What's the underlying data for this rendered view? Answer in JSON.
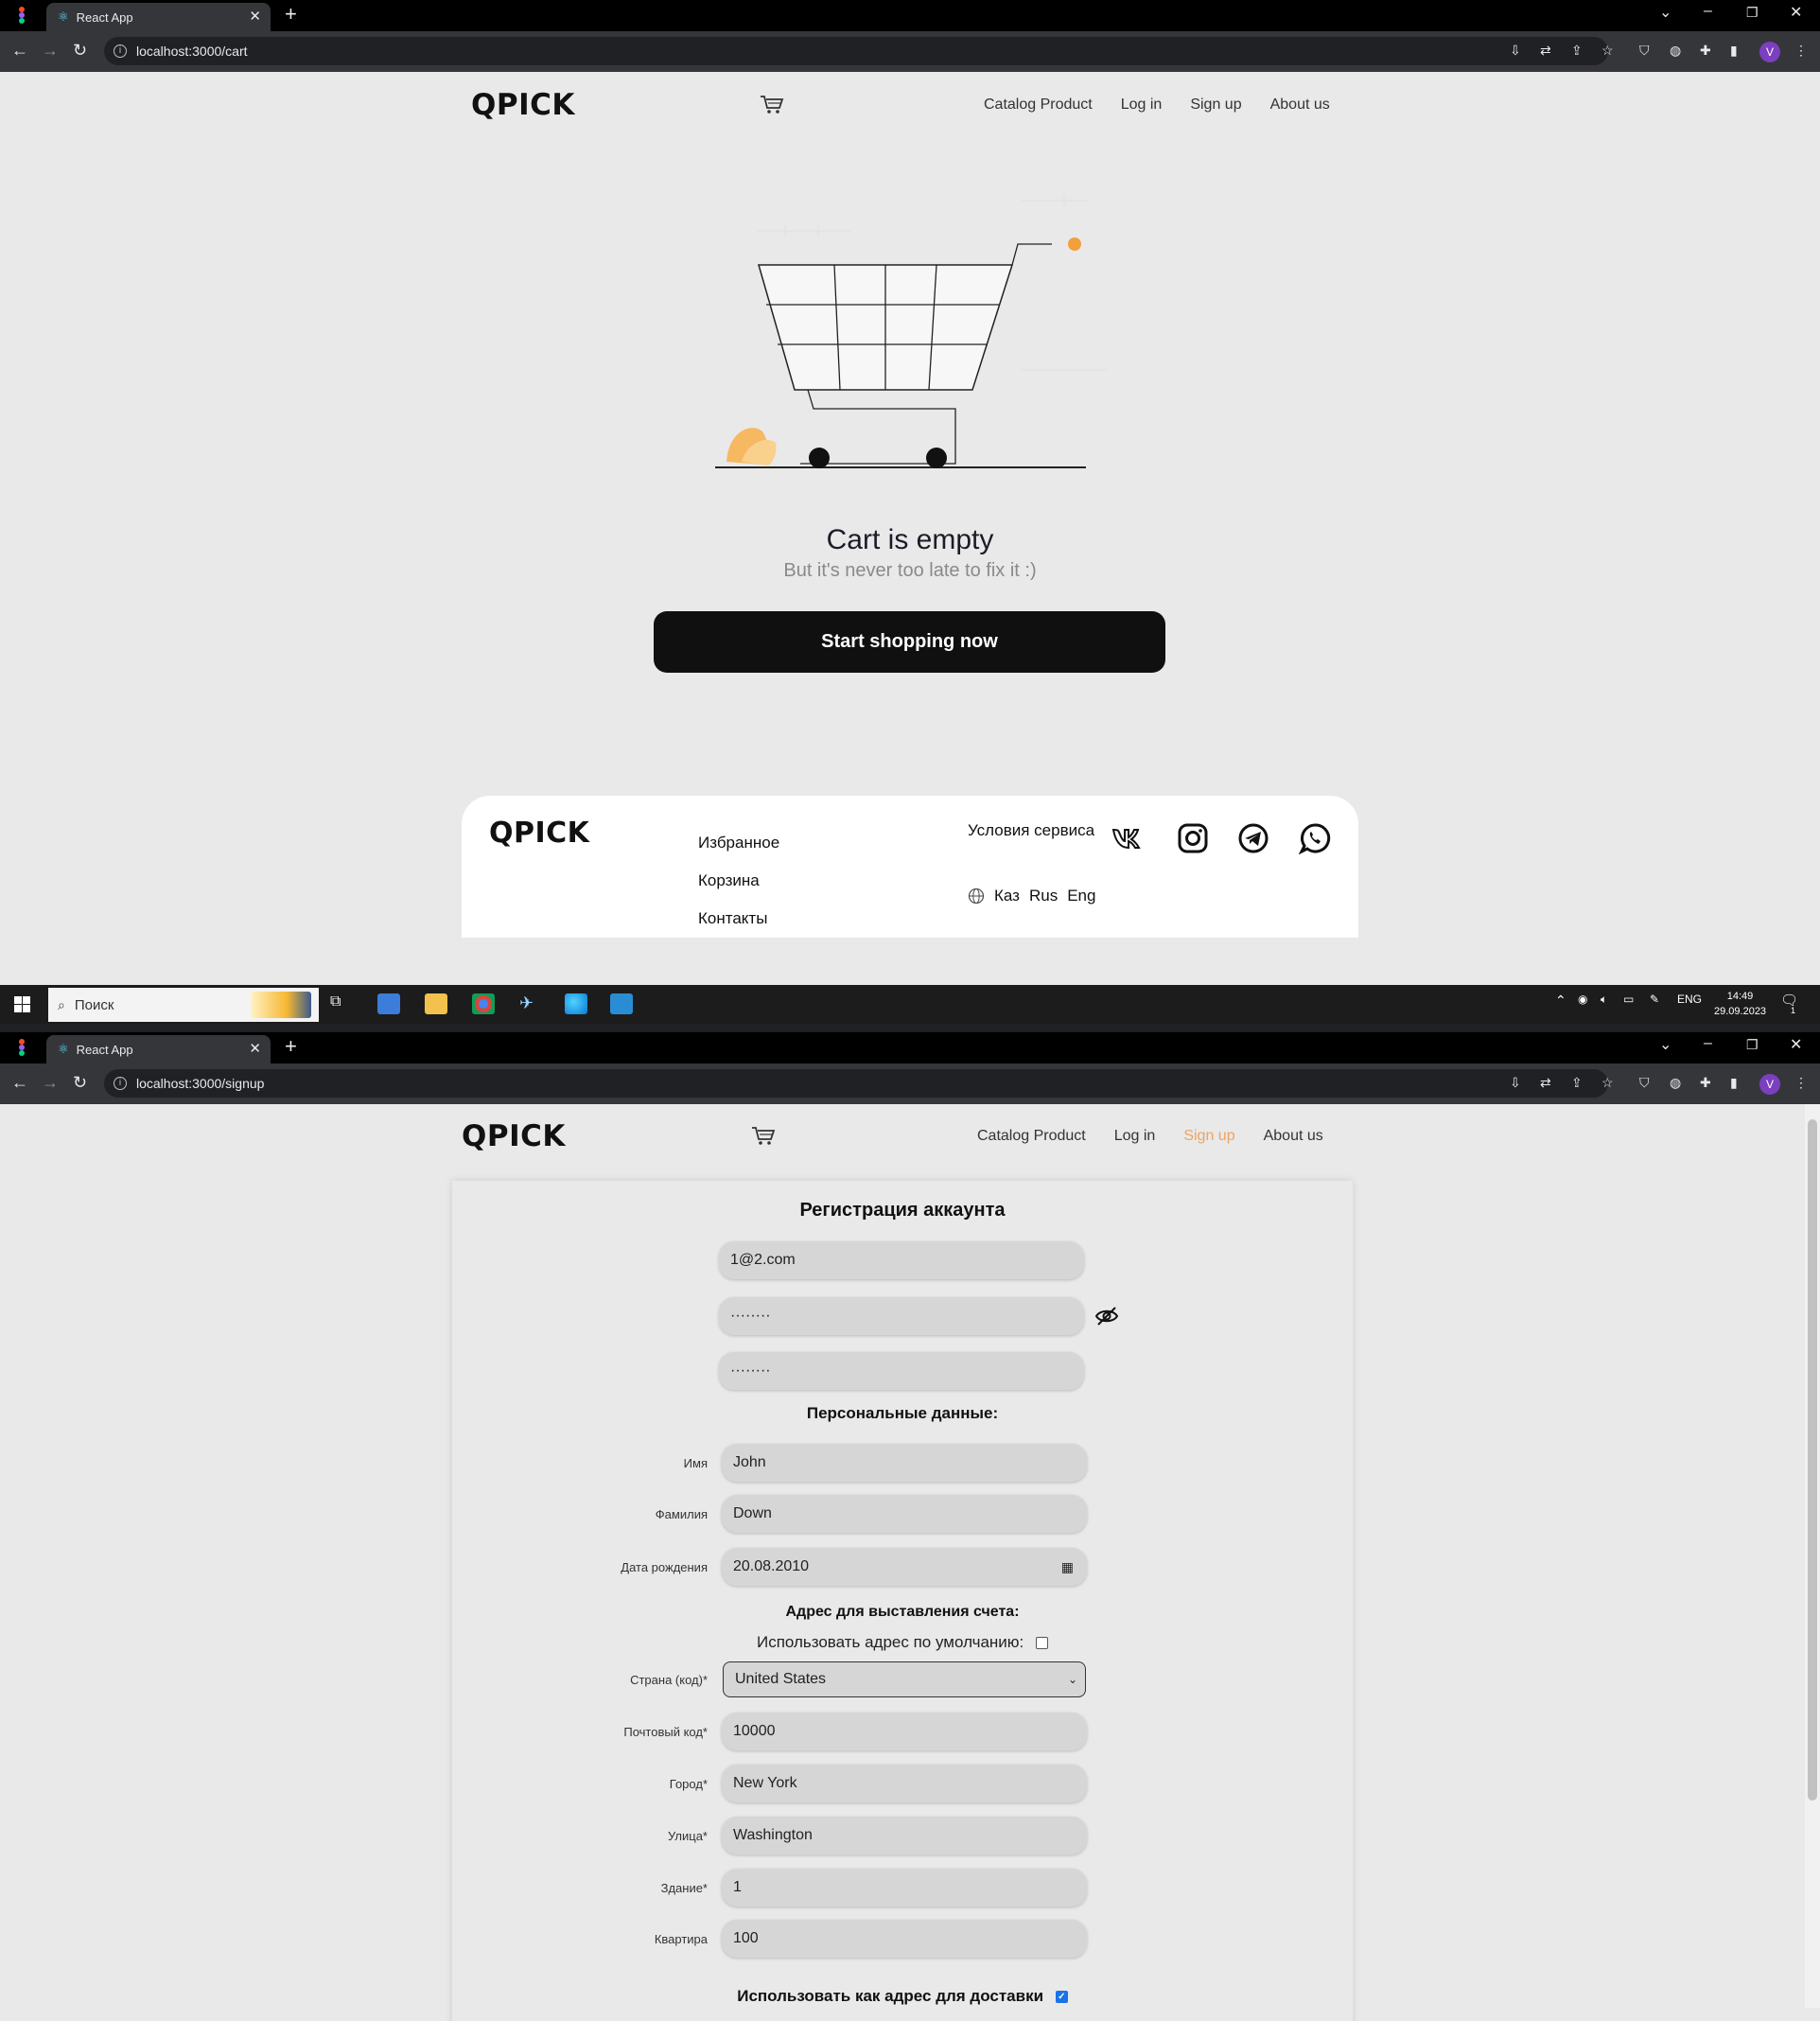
{
  "window1": {
    "tab_title": "React App",
    "url": "localhost:3000/cart",
    "header": {
      "logo": "QPICK",
      "nav": [
        "Catalog Product",
        "Log in",
        "Sign up",
        "About us"
      ]
    },
    "empty": {
      "title": "Cart is empty",
      "subtitle": "But it's never too late to fix it :)",
      "button": "Start shopping now"
    },
    "footer": {
      "logo": "QPICK",
      "links": [
        "Избранное",
        "Корзина",
        "Контакты"
      ],
      "terms": "Условия сервиса",
      "languages": [
        "Каз",
        "Rus",
        "Eng"
      ],
      "social_icons": [
        "vk-icon",
        "instagram-icon",
        "telegram-icon",
        "whatsapp-icon"
      ]
    }
  },
  "taskbar": {
    "search_placeholder": "Поиск",
    "lang": "ENG",
    "time": "14:49",
    "date": "29.09.2023",
    "notifications": "1"
  },
  "window2": {
    "tab_title": "React App",
    "url": "localhost:3000/signup",
    "header": {
      "logo": "QPICK",
      "nav": [
        "Catalog Product",
        "Log in",
        "Sign up",
        "About us"
      ],
      "active": "Sign up"
    },
    "form": {
      "title": "Регистрация аккаунта",
      "email": "1@2.com",
      "password": "········",
      "password_confirm": "········",
      "personal_title": "Персональные данные:",
      "first_name_label": "Имя",
      "first_name": "John",
      "last_name_label": "Фамилия",
      "last_name": "Down",
      "birth_label": "Дата рождения",
      "birth": "20.08.2010",
      "billing_title": "Адрес для выставления счета:",
      "default_address_label": "Использовать адрес по умолчанию:",
      "default_address_checked": false,
      "country_label": "Страна (код)*",
      "country": "United States",
      "postal_label": "Почтовый код*",
      "postal": "10000",
      "city_label": "Город*",
      "city": "New York",
      "street_label": "Улица*",
      "street": "Washington",
      "building_label": "Здание*",
      "building": "1",
      "apartment_label": "Квартира",
      "apartment": "100",
      "use_as_shipping_label": "Использовать как адрес для доставки",
      "use_as_shipping_checked": true
    }
  },
  "colors": {
    "accent": "#f0a35f",
    "button": "#101010",
    "page_bg": "#e9e9e9",
    "input_bg": "#d6d6d6"
  }
}
